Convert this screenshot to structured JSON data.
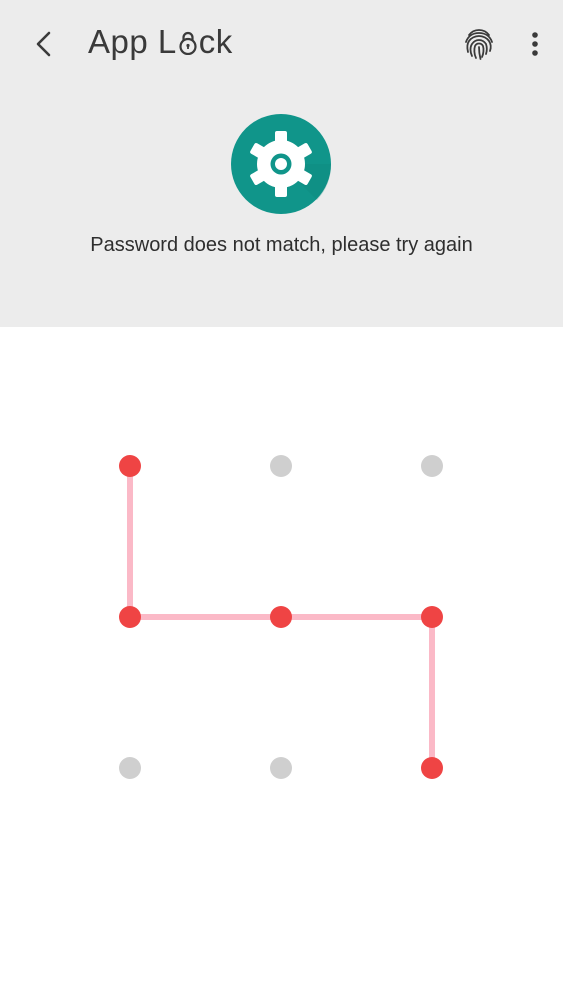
{
  "header": {
    "title_prefix": "App L",
    "title_suffix": "ck",
    "back_icon": "chevron-left-icon",
    "fingerprint_icon": "fingerprint-icon",
    "more_icon": "more-vert-icon"
  },
  "app_icon": {
    "icon": "settings-gear-icon",
    "color": "#10958a"
  },
  "status": {
    "message": "Password does not match, please try again"
  },
  "pattern": {
    "active_color": "#ef4444",
    "inactive_color": "#cfcfcf",
    "line_color": "#fbb9c7",
    "selected_sequence": [
      0,
      3,
      4,
      5,
      8
    ],
    "dots": [
      {
        "index": 0,
        "active": true
      },
      {
        "index": 1,
        "active": false
      },
      {
        "index": 2,
        "active": false
      },
      {
        "index": 3,
        "active": true
      },
      {
        "index": 4,
        "active": true
      },
      {
        "index": 5,
        "active": true
      },
      {
        "index": 6,
        "active": false
      },
      {
        "index": 7,
        "active": false
      },
      {
        "index": 8,
        "active": true
      }
    ]
  }
}
